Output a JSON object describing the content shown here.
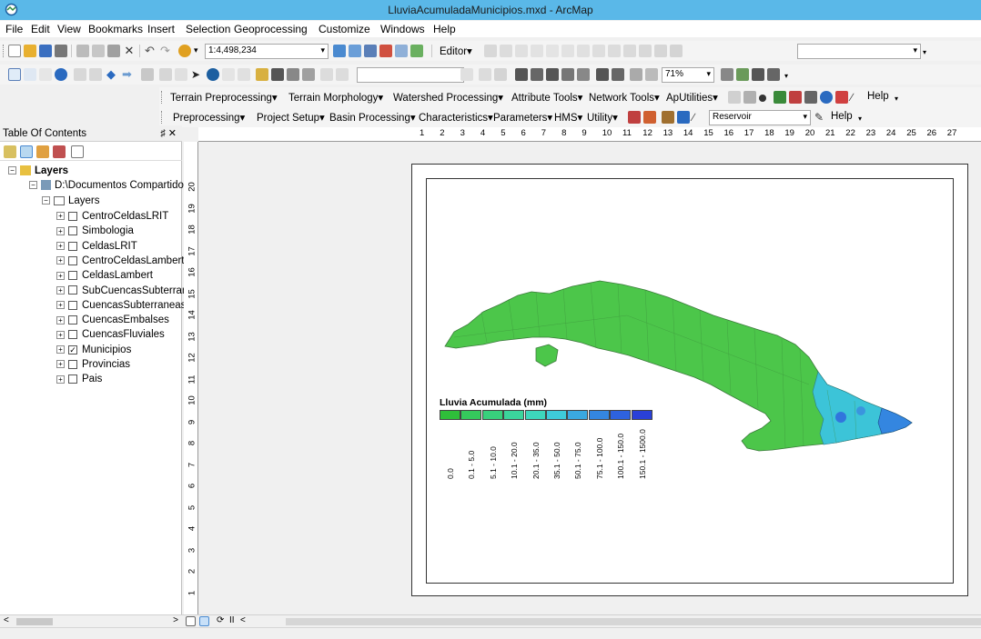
{
  "window": {
    "title": "LluviaAcumuladaMunicipios.mxd - ArcMap"
  },
  "menu": [
    "File",
    "Edit",
    "View",
    "Bookmarks",
    "Insert",
    "Selection",
    "Geoprocessing",
    "Customize",
    "Windows",
    "Help"
  ],
  "toolbar1": {
    "scale": "1:4,498,234",
    "editor_label": "Editor▾"
  },
  "toolbar2": {
    "zoom_value": "71%"
  },
  "toolbar3": {
    "items": [
      "Terrain Preprocessing▾",
      "Terrain Morphology▾",
      "Watershed Processing▾",
      "Attribute Tools▾",
      "Network Tools▾",
      "ApUtilities▾"
    ],
    "help": "Help"
  },
  "toolbar4": {
    "items": [
      "Preprocessing▾",
      "Project Setup▾",
      "Basin Processing▾",
      "Characteristics▾",
      "Parameters▾",
      "HMS▾",
      "Utility▾"
    ],
    "reservoir": "Reservoir",
    "help": "Help"
  },
  "toc": {
    "title": "Table Of Contents",
    "controls": "♯ ✕",
    "root": "Layers",
    "group": "D:\\Documentos Compartido",
    "subgroup": "Layers",
    "layers": [
      {
        "name": "CentroCeldasLRIT",
        "checked": false
      },
      {
        "name": "Simbologia",
        "checked": false
      },
      {
        "name": "CeldasLRIT",
        "checked": false
      },
      {
        "name": "CentroCeldasLambert",
        "checked": false
      },
      {
        "name": "CeldasLambert",
        "checked": false
      },
      {
        "name": "SubCuencasSubterran",
        "checked": false
      },
      {
        "name": "CuencasSubterraneas",
        "checked": false
      },
      {
        "name": "CuencasEmbalses",
        "checked": false
      },
      {
        "name": "CuencasFluviales",
        "checked": false
      },
      {
        "name": "Municipios",
        "checked": true
      },
      {
        "name": "Provincias",
        "checked": false
      },
      {
        "name": "Pais",
        "checked": false
      }
    ]
  },
  "ruler_top": [
    "1",
    "2",
    "3",
    "4",
    "5",
    "6",
    "7",
    "8",
    "9",
    "10",
    "11",
    "12",
    "13",
    "14",
    "15",
    "16",
    "17",
    "18",
    "19",
    "20",
    "21",
    "22",
    "23",
    "24",
    "25",
    "26",
    "27"
  ],
  "ruler_left": [
    "20",
    "19",
    "18",
    "17",
    "16",
    "15",
    "14",
    "13",
    "12",
    "11",
    "10",
    "9",
    "8",
    "7",
    "6",
    "5",
    "4",
    "3",
    "2",
    "1"
  ],
  "legend": {
    "title": "Lluvia Acumulada (mm)",
    "classes": [
      {
        "label": "0.0",
        "color": "#2fbf3a"
      },
      {
        "label": "0.1 - 5.0",
        "color": "#35c95c"
      },
      {
        "label": "5.1 - 10.0",
        "color": "#38d07c"
      },
      {
        "label": "10.1 - 20.0",
        "color": "#3bd49c"
      },
      {
        "label": "20.1 - 35.0",
        "color": "#3dd7bc"
      },
      {
        "label": "35.1 - 50.0",
        "color": "#3ecbd9"
      },
      {
        "label": "50.1 - 75.0",
        "color": "#3aa8e0"
      },
      {
        "label": "75.1 - 100.0",
        "color": "#3486e0"
      },
      {
        "label": "100.1 - 150.0",
        "color": "#2e62de"
      },
      {
        "label": "150.1 - 1500.0",
        "color": "#2a40d8"
      }
    ]
  },
  "colors": {
    "titlebar": "#5ab8e8",
    "land": "#4cc64a",
    "east": "#3cc4d8"
  }
}
